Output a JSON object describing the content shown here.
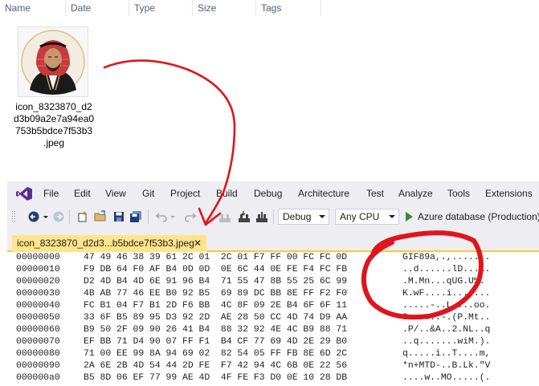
{
  "explorer": {
    "columns": [
      "Name",
      "Date",
      "Type",
      "Size",
      "Tags"
    ],
    "file": {
      "name_lines": [
        "icon_8323870_d2",
        "d3b09a2e7a94ea0",
        "753b5bdce7f53b3",
        ".jpeg"
      ]
    }
  },
  "vs": {
    "menu": [
      "File",
      "Edit",
      "View",
      "Git",
      "Project",
      "Build",
      "Debug",
      "Architecture",
      "Test",
      "Analyze",
      "Tools",
      "Extensions"
    ],
    "toolbar": {
      "config": "Debug",
      "platform": "Any CPU",
      "run_target": "Azure database (Production)"
    },
    "tab": {
      "title": "icon_8323870_d2d3...b5bdce7f53b3.jpeg",
      "close": "✕"
    },
    "hex_rows": [
      {
        "offset": "00000000",
        "bytes": "47 49 46 38 39 61 2C 01  2C 01 F7 FF 00 FC FC 0D",
        "ascii": "GIF89a,.,......."
      },
      {
        "offset": "00000010",
        "bytes": "F9 DB 64 F0 AF B4 0D 0D  0E 6C 44 0E FE F4 FC FB",
        "ascii": "..d......lD...l."
      },
      {
        "offset": "00000020",
        "bytes": "D2 4D B4 4D 6E 91 96 B4  71 55 47 8B 55 25 6C 99",
        "ascii": ".M.Mn...qUG.U%."
      },
      {
        "offset": "00000030",
        "bytes": "4B AB 77 46 EE B0 92 B5  69 89 DC BB 8E FF F2 F0",
        "ascii": "K.wF....i......."
      },
      {
        "offset": "00000040",
        "bytes": "FC B1 04 F7 B1 2D F6 BB  4C 8F 09 2E B4 6F 6F 11",
        "ascii": ".....-..L....oo."
      },
      {
        "offset": "00000050",
        "bytes": "33 6F B5 89 95 D3 92 2D  AE 28 50 CC 4D 74 D9 AA",
        "ascii": "3o.....-.(P.Mt.."
      },
      {
        "offset": "00000060",
        "bytes": "B9 50 2F 09 90 26 41 B4  88 32 92 4E 4C B9 88 71",
        "ascii": ".P/..&A..2.NL..q"
      },
      {
        "offset": "00000070",
        "bytes": "EF BB 71 D4 90 07 FF F1  B4 CF 77 69 4D 2E 29 B0",
        "ascii": "..q.......wiM.)."
      },
      {
        "offset": "00000080",
        "bytes": "71 00 EE 99 8A 94 69 02  82 54 05 FF FB 8E 6D 2C",
        "ascii": "q.....i..T....m,"
      },
      {
        "offset": "00000090",
        "bytes": "2A 6E 2B 4D 54 44 2D FE  F7 42 94 4C 6B 0E 22 56",
        "ascii": "*n+MTD-..B.Lk.\"V"
      },
      {
        "offset": "000000a0",
        "bytes": "B5 8D 06 EF 77 99 AE 4D  4F FE F3 D0 0E 10 28 DB",
        "ascii": "....w..MO.....(."
      }
    ]
  },
  "colors": {
    "annotation": "#e0141c",
    "tab_active": "#ffe48a",
    "tab_accent": "#ffc83d",
    "vs_purple": "#5c2d91"
  }
}
